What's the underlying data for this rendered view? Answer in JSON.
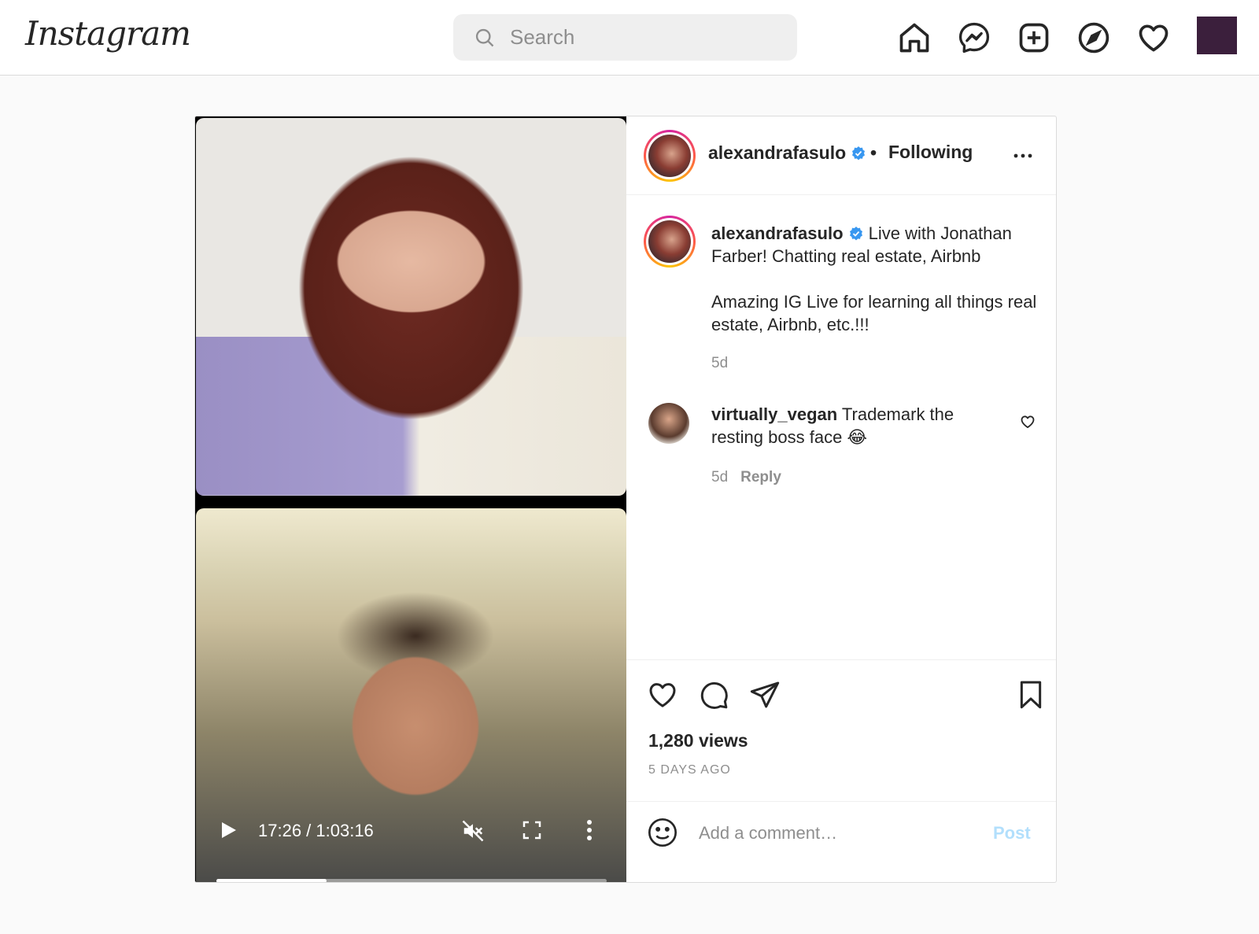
{
  "nav": {
    "logo": "Instagram",
    "search_placeholder": "Search",
    "icons": [
      "home-icon",
      "messenger-icon",
      "new-post-icon",
      "explore-icon",
      "activity-heart-icon"
    ]
  },
  "media": {
    "time": "17:26 / 1:03:16",
    "progress": 0.283,
    "muted": true
  },
  "post": {
    "username": "alexandrafasulo",
    "dot": "•",
    "following": "Following",
    "caption_text": "Live with Jonathan Farber! Chatting real estate, Airbnb",
    "caption_text_2": "Amazing IG Live for learning all things real estate, Airbnb, etc.!!!",
    "caption_time": "5d",
    "comment": {
      "username": "virtually_vegan",
      "text": "Trademark the resting boss face 😂",
      "time": "5d",
      "reply": "Reply"
    },
    "views": "1,280 views",
    "date": "5 DAYS AGO",
    "add_comment_placeholder": "Add a comment…",
    "post_label": "Post"
  },
  "colors": {
    "verified": "#3897f0",
    "post_button": "#b2dffc",
    "avatar_square": "#3b1f3c"
  }
}
